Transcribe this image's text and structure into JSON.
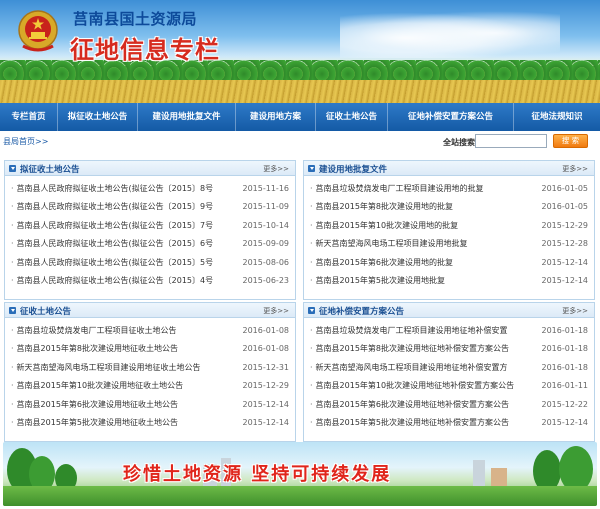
{
  "header": {
    "agency_name": "莒南县国土资源局",
    "site_title": "征地信息专栏"
  },
  "nav": {
    "items": [
      "专栏首页",
      "拟征收土地公告",
      "建设用地批复文件",
      "建设用地方案",
      "征收土地公告",
      "征地补偿安置方案公告",
      "征地法规知识"
    ]
  },
  "breadcrumb": "县局首页>>",
  "search": {
    "label": "全站搜索:",
    "value": "",
    "button_label": "搜 索"
  },
  "more_label": "更多>>",
  "panels": [
    {
      "title": "拟征收土地公告",
      "items": [
        {
          "text": "莒南县人民政府拟征收土地公告(拟征公告〔2015〕8号",
          "date": "2015-11-16"
        },
        {
          "text": "莒南县人民政府拟征收土地公告(拟征公告〔2015〕9号",
          "date": "2015-11-09"
        },
        {
          "text": "莒南县人民政府拟征收土地公告(拟征公告〔2015〕7号",
          "date": "2015-10-14"
        },
        {
          "text": "莒南县人民政府拟征收土地公告(拟征公告〔2015〕6号",
          "date": "2015-09-09"
        },
        {
          "text": "莒南县人民政府拟征收土地公告(拟征公告〔2015〕5号",
          "date": "2015-08-06"
        },
        {
          "text": "莒南县人民政府拟征收土地公告(拟征公告〔2015〕4号",
          "date": "2015-06-23"
        }
      ]
    },
    {
      "title": "建设用地批复文件",
      "items": [
        {
          "text": "莒南县垃圾焚烧发电厂工程项目建设用地的批复",
          "date": "2016-01-05"
        },
        {
          "text": "莒南县2015年第8批次建设用地的批复",
          "date": "2016-01-05"
        },
        {
          "text": "莒南县2015年第10批次建设用地的批复",
          "date": "2015-12-29"
        },
        {
          "text": "新天莒南望海风电场工程项目建设用地批复",
          "date": "2015-12-28"
        },
        {
          "text": "莒南县2015年第6批次建设用地的批复",
          "date": "2015-12-14"
        },
        {
          "text": "莒南县2015年第5批次建设用地批复",
          "date": "2015-12-14"
        }
      ]
    },
    {
      "title": "征收土地公告",
      "items": [
        {
          "text": "莒南县垃圾焚烧发电厂工程项目征收土地公告",
          "date": "2016-01-08"
        },
        {
          "text": "莒南县2015年第8批次建设用地征收土地公告",
          "date": "2016-01-08"
        },
        {
          "text": "新天莒南望海风电场工程项目建设用地征收土地公告",
          "date": "2015-12-31"
        },
        {
          "text": "莒南县2015年第10批次建设用地征收土地公告",
          "date": "2015-12-29"
        },
        {
          "text": "莒南县2015年第6批次建设用地征收土地公告",
          "date": "2015-12-14"
        },
        {
          "text": "莒南县2015年第5批次建设用地征收土地公告",
          "date": "2015-12-14"
        }
      ]
    },
    {
      "title": "征地补偿安置方案公告",
      "items": [
        {
          "text": "莒南县垃圾焚烧发电厂工程项目建设用地征地补偿安置",
          "date": "2016-01-18"
        },
        {
          "text": "莒南县2015年第8批次建设用地征地补偿安置方案公告",
          "date": "2016-01-18"
        },
        {
          "text": "新天莒南望海风电场工程项目建设用地征地补偿安置方",
          "date": "2016-01-18"
        },
        {
          "text": "莒南县2015年第10批次建设用地征地补偿安置方案公告",
          "date": "2016-01-11"
        },
        {
          "text": "莒南县2015年第6批次建设用地征地补偿安置方案公告",
          "date": "2015-12-22"
        },
        {
          "text": "莒南县2015年第5批次建设用地征地补偿安置方案公告",
          "date": "2015-12-14"
        }
      ]
    }
  ],
  "footer": {
    "slogan": "珍惜土地资源  坚持可持续发展"
  },
  "colors": {
    "nav_bg": "#1c63b0",
    "title_red": "#d62b1f",
    "panel_title": "#1a4f92",
    "search_button": "#f5861c"
  }
}
